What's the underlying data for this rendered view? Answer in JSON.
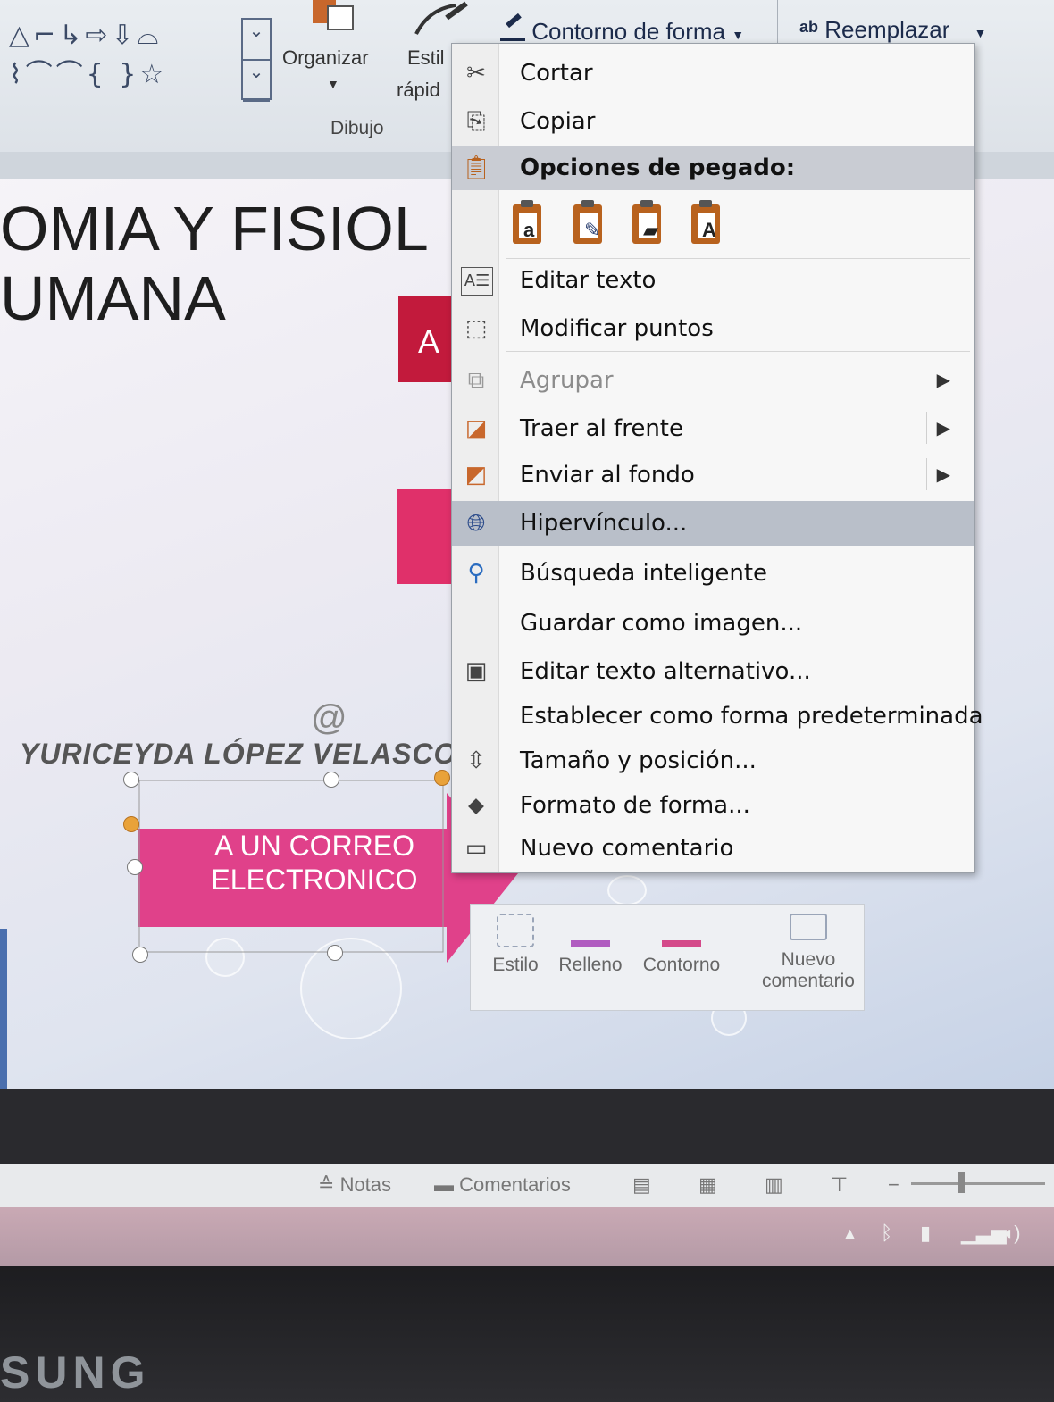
{
  "ribbon": {
    "shapes_row1": "△⌐↳⇨⇩⌓",
    "shapes_row2": "⌇⌒⌒{ }☆",
    "organizar": "Organizar",
    "estilos_top": "Estil",
    "estilos_bottom": "rápid",
    "dibujo_group": "Dibujo",
    "contorno_forma": "Contorno de forma",
    "reemplazar_icon": "ab",
    "reemplazar": "Reemplazar"
  },
  "slide": {
    "title_line1": "OMIA Y FISIOL",
    "title_line2": "UMANA",
    "red_box_letter": "A",
    "author": "YURICEYDA LÓPEZ VELASCO",
    "arrow_label_line1": "A UN CORREO",
    "arrow_label_line2": "ELECTRONICO"
  },
  "context_menu": {
    "cortar": "Cortar",
    "copiar": "Copiar",
    "opciones_pegado": "Opciones de pegado:",
    "editar_texto": "Editar texto",
    "modificar_puntos": "Modificar puntos",
    "agrupar": "Agrupar",
    "traer_al_frente": "Traer al frente",
    "enviar_al_fondo": "Enviar al fondo",
    "hipervinculo": "Hipervínculo...",
    "busqueda_inteligente": "Búsqueda inteligente",
    "guardar_como_imagen": "Guardar como imagen...",
    "editar_texto_alternativo": "Editar texto alternativo...",
    "establecer_predeterminada": "Establecer como forma predeterminada",
    "tamano_posicion": "Tamaño y posición...",
    "formato_forma": "Formato de forma...",
    "nuevo_comentario": "Nuevo comentario"
  },
  "mini_toolbar": {
    "estilo": "Estilo",
    "relleno": "Relleno",
    "contorno": "Contorno",
    "nuevo_line1": "Nuevo",
    "nuevo_line2": "comentario"
  },
  "status_bar": {
    "notas": "Notas",
    "comentarios": "Comentarios"
  },
  "device": {
    "brand": "SUNG"
  },
  "colors": {
    "selection_highlight": "#b9bfc9",
    "arrow_pink": "#e0418a",
    "red_box": "#c21a3c",
    "menu_icon_orange": "#b8621e"
  }
}
